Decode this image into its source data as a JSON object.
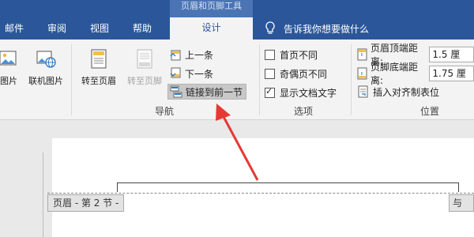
{
  "title_bar": {
    "context_label": "页眉和页脚工具"
  },
  "tabs": [
    {
      "label": "邮件"
    },
    {
      "label": "审阅"
    },
    {
      "label": "视图"
    },
    {
      "label": "帮助"
    },
    {
      "label": "设计"
    }
  ],
  "tell_me": {
    "text": "告诉我你想要做什么"
  },
  "ribbon": {
    "insert_group": {
      "picture_label": "图片",
      "online_picture_label": "联机图片"
    },
    "navigation_group": {
      "label": "导航",
      "goto_header": "转至页眉",
      "goto_footer": "转至页脚",
      "previous": "上一条",
      "next": "下一条",
      "link_to_previous": "链接到前一节"
    },
    "options_group": {
      "label": "选项",
      "different_first_page": "首页不同",
      "different_odd_even": "奇偶页不同",
      "show_document_text": "显示文档文字",
      "different_first_page_checked": false,
      "different_odd_even_checked": false,
      "show_document_text_checked": true
    },
    "position_group": {
      "label": "位置",
      "header_top_label": "页眉顶端距离:",
      "header_top_value": "1.5 厘",
      "footer_bottom_label": "页脚底端距离:",
      "footer_bottom_value": "1.75 厘",
      "insert_alignment_tab": "插入对齐制表位"
    }
  },
  "document": {
    "header_tag_left": "页眉 - 第 2 节 -",
    "header_tag_right": "与上"
  },
  "colors": {
    "title_bar": "#2b579a",
    "arrow": "#e53935"
  }
}
